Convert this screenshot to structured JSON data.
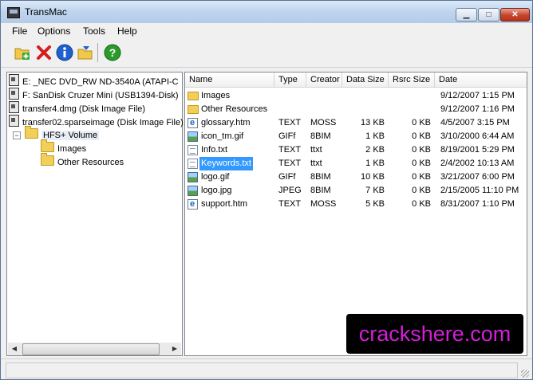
{
  "window": {
    "title": "TransMac",
    "min_glyph": "▁",
    "max_glyph": "□",
    "close_glyph": "✕"
  },
  "menu": [
    "File",
    "Options",
    "Tools",
    "Help"
  ],
  "toolbar": {
    "buttons": [
      {
        "name": "add-files",
        "icon": "folder-add-icon",
        "color": "#f2c84a"
      },
      {
        "name": "delete",
        "icon": "delete-x-icon",
        "color": "#d41f1f"
      },
      {
        "name": "info",
        "icon": "info-icon",
        "color": "#1f5fd0"
      },
      {
        "name": "extract",
        "icon": "folder-extract-icon",
        "color": "#f2c84a"
      },
      {
        "name": "help",
        "icon": "help-icon",
        "color": "#2a9a2a"
      }
    ]
  },
  "tree": {
    "items": [
      {
        "label": "E: _NEC DVD_RW ND-3540A (ATAPI-C",
        "icon": "optical-drive-icon"
      },
      {
        "label": "F: SanDisk Cruzer Mini (USB1394-Disk)",
        "icon": "usb-drive-icon"
      },
      {
        "label": "transfer4.dmg (Disk Image File)",
        "icon": "disk-image-icon"
      },
      {
        "label": "transfer02.sparseimage (Disk Image File)",
        "icon": "disk-image-icon"
      },
      {
        "label": "HFS+ Volume",
        "icon": "folder-icon"
      },
      {
        "label": "Images",
        "icon": "folder-icon"
      },
      {
        "label": "Other Resources",
        "icon": "folder-icon"
      }
    ],
    "expander": "−",
    "scroll_left": "◀",
    "scroll_right": "▶"
  },
  "columns": [
    "Name",
    "Type",
    "Creator",
    "Data Size",
    "Rsrc Size",
    "Date"
  ],
  "files": [
    {
      "name": "Images",
      "type": "",
      "creator": "",
      "data": "",
      "rsrc": "",
      "date": "9/12/2007 1:15 PM",
      "icon": "folder"
    },
    {
      "name": "Other Resources",
      "type": "",
      "creator": "",
      "data": "",
      "rsrc": "",
      "date": "9/12/2007 1:16 PM",
      "icon": "folder"
    },
    {
      "name": "glossary.htm",
      "type": "TEXT",
      "creator": "MOSS",
      "data": "13 KB",
      "rsrc": "0 KB",
      "date": "4/5/2007 3:15 PM",
      "icon": "htm"
    },
    {
      "name": "icon_tm.gif",
      "type": "GIFf",
      "creator": "8BIM",
      "data": "1 KB",
      "rsrc": "0 KB",
      "date": "3/10/2000 6:44 AM",
      "icon": "img"
    },
    {
      "name": "Info.txt",
      "type": "TEXT",
      "creator": "ttxt",
      "data": "2 KB",
      "rsrc": "0 KB",
      "date": "8/19/2001 5:29 PM",
      "icon": "txt"
    },
    {
      "name": "Keywords.txt",
      "type": "TEXT",
      "creator": "ttxt",
      "data": "1 KB",
      "rsrc": "0 KB",
      "date": "2/4/2002 10:13 AM",
      "icon": "txt",
      "selected": true
    },
    {
      "name": "logo.gif",
      "type": "GIFf",
      "creator": "8BIM",
      "data": "10 KB",
      "rsrc": "0 KB",
      "date": "3/21/2007 6:00 PM",
      "icon": "img"
    },
    {
      "name": "logo.jpg",
      "type": "JPEG",
      "creator": "8BIM",
      "data": "7 KB",
      "rsrc": "0 KB",
      "date": "2/15/2005 11:10 PM",
      "icon": "img"
    },
    {
      "name": "support.htm",
      "type": "TEXT",
      "creator": "MOSS",
      "data": "5 KB",
      "rsrc": "0 KB",
      "date": "8/31/2007 1:10 PM",
      "icon": "htm"
    }
  ],
  "status": {
    "text": ""
  },
  "watermark": "crackshere.com",
  "colors": {
    "selection": "#3399ff",
    "watermark_text": "#d21fd8",
    "watermark_bg": "#000000"
  }
}
